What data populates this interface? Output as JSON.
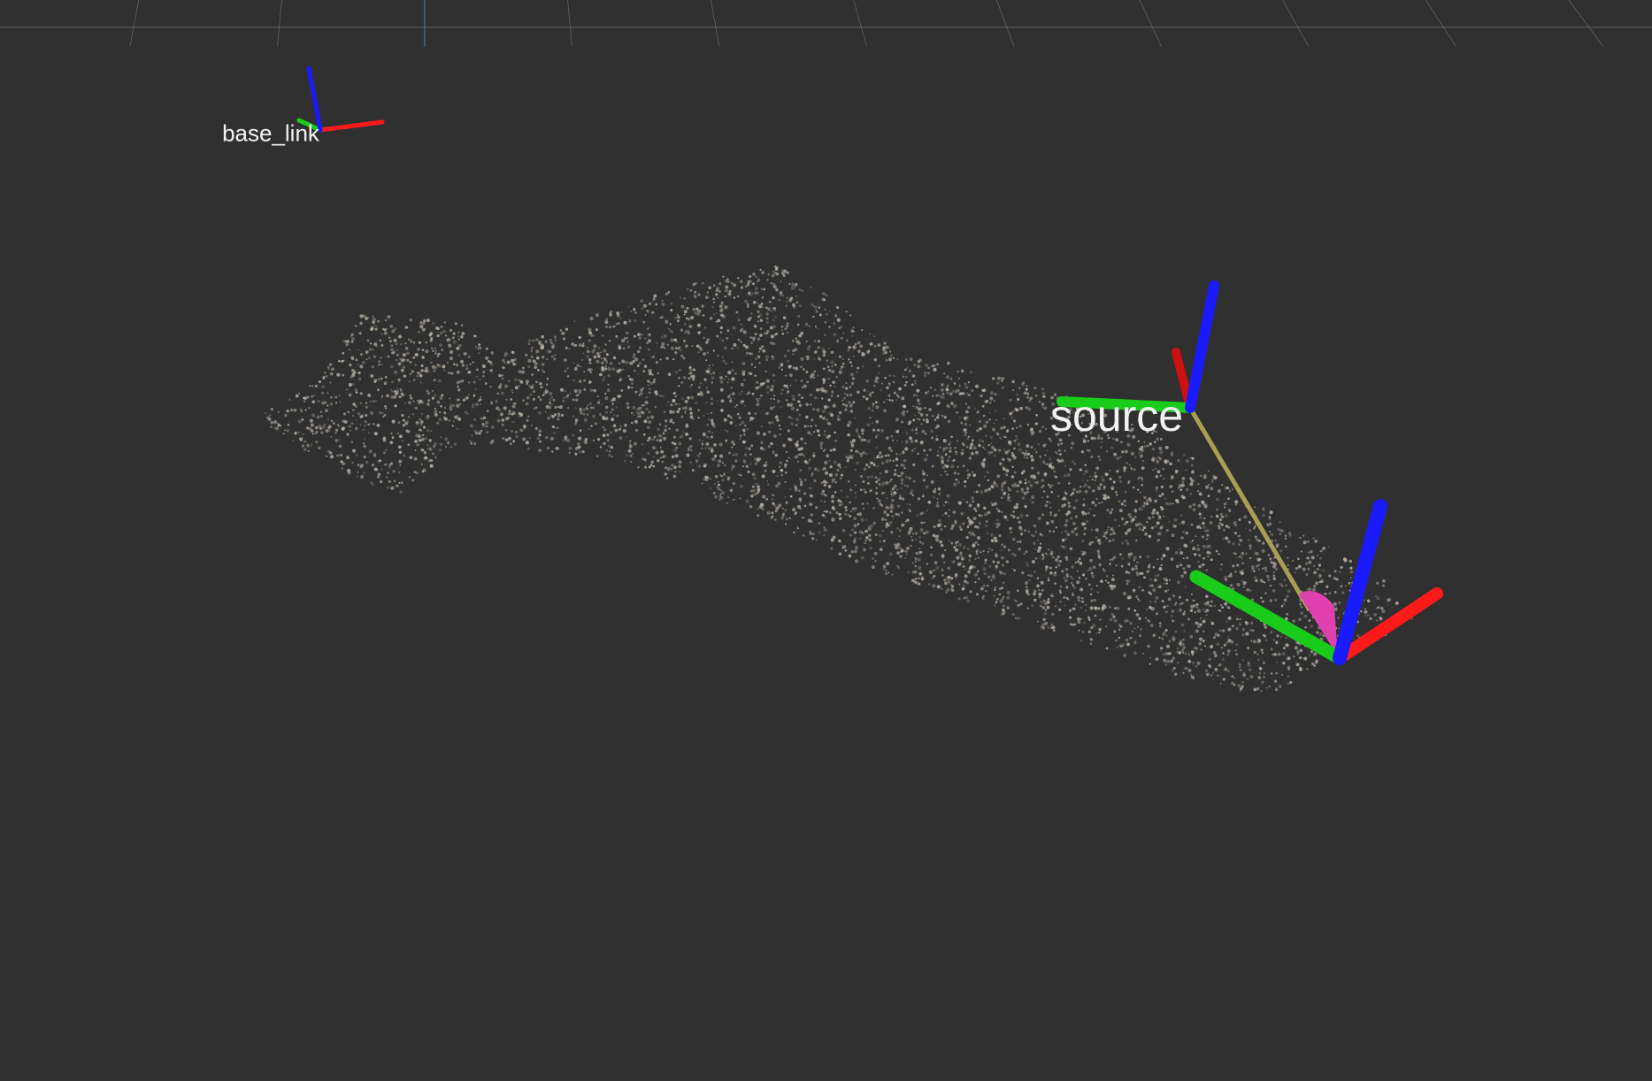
{
  "scene": {
    "background_color": "#303030",
    "grid": true,
    "grid_color": "#8a8a8a",
    "grid_axis_color": "#4a6a9e",
    "point_cloud_color": "#bdb6aa"
  },
  "frames": {
    "base_link": {
      "label": "base_link",
      "x_axis_color": "#ff1a1a",
      "y_axis_color": "#1acc1a",
      "z_axis_color": "#1a1aff"
    },
    "source": {
      "label": "source",
      "x_axis_color": "#ff1a1a",
      "y_axis_color": "#1acc1a",
      "z_axis_color": "#1a1aff"
    },
    "target": {
      "label": "",
      "x_axis_color": "#ff1a1a",
      "y_axis_color": "#1acc1a",
      "z_axis_color": "#1a1aff"
    }
  },
  "tf_link": {
    "line_color": "#a8a050",
    "arrow_color": "#e040b0"
  }
}
